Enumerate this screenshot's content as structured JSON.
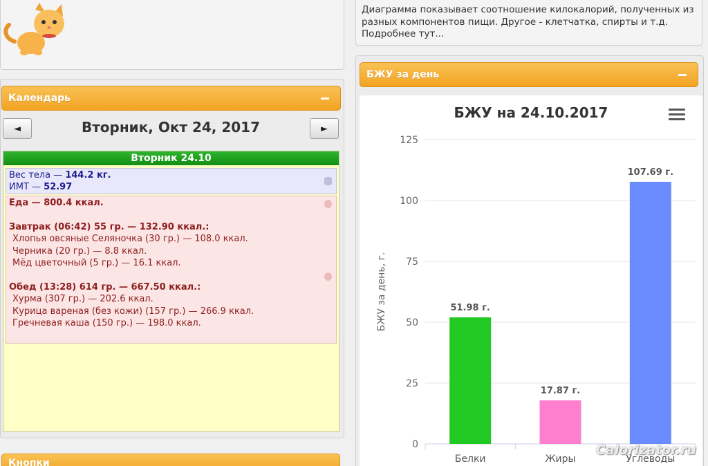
{
  "left": {
    "calendar": {
      "header": "Календарь",
      "prev_label": "◄",
      "next_label": "►",
      "date_title": "Вторник, Окт 24, 2017",
      "day_header": "Вторник 24.10",
      "weight_line_label": "Вес тела — ",
      "weight_value": "144.2 кг.",
      "bmi_label": "ИМТ — ",
      "bmi_value": "52.97",
      "food_total": "Еда — 800.4 ккал.",
      "meals": [
        {
          "title": "Завтрак (06:42) 55 гр. — 132.90 ккал.:",
          "items": [
            "Хлопья овсяные Селяночка (30 гр.) — 108.0 ккал.",
            "Черника (20 гр.) — 8.8 ккал.",
            "Мёд цветочный (5 гр.) — 16.1 ккал."
          ]
        },
        {
          "title": "Обед (13:28) 614 гр. — 667.50 ккал.:",
          "items": [
            "Хурма (307 гр.) — 202.6 ккал.",
            "Курица вареная (без кожи) (157 гр.) — 266.9 ккал.",
            "Гречневая каша (150 гр.) — 198.0 ккал."
          ]
        }
      ]
    },
    "bottom_header": "Кнопки"
  },
  "right": {
    "info_text": "Диаграмма показывает соотношение килокалорий, полученных из разных компонентов пищи. Другое - клетчатка, спирты и т.д. Подробнее тут...",
    "panel_header": "БЖУ за день",
    "watermark": "Calorizator.ru"
  },
  "colors": {
    "orange": "#f2a322",
    "green": "#22c922",
    "pink": "#ff7fcf",
    "blue": "#6a8cff"
  },
  "chart_data": {
    "type": "bar",
    "title": "БЖУ на 24.10.2017",
    "ylabel": "БЖУ за день, г.",
    "xlabel": "",
    "categories": [
      "Белки",
      "Жиры",
      "Углеводы"
    ],
    "values": [
      51.98,
      17.87,
      107.69
    ],
    "data_labels": [
      "51.98 г.",
      "17.87 г.",
      "107.69 г."
    ],
    "colors": [
      "#22c922",
      "#ff7fcf",
      "#6a8cff"
    ],
    "ylim": [
      0,
      125
    ],
    "yticks": [
      "0",
      "25",
      "50",
      "75",
      "100",
      "125"
    ],
    "grid": true,
    "legend": "none"
  }
}
